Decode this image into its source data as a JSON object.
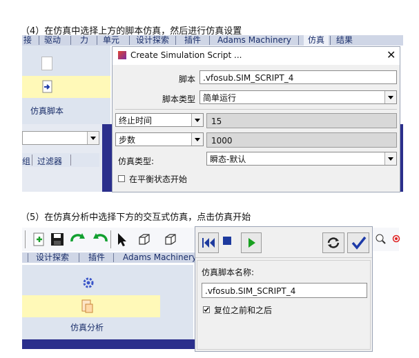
{
  "section4": {
    "caption": "（4）在仿真中选择上方的脚本仿真，然后进行仿真设置",
    "tabs": [
      "接",
      "驱动",
      "力",
      "单元",
      "设计探索",
      "插件",
      "Adams Machinery",
      "仿真",
      "结果"
    ],
    "left_panel": {
      "script_label": "仿真脚本",
      "filter_tab": "过滤器",
      "tab_partial": "组"
    },
    "dialog": {
      "title": "Create Simulation Script ...",
      "script_label": "脚本",
      "script_value": ".vfosub.SIM_SCRIPT_4",
      "script_type_label": "脚本类型",
      "script_type_value": "简单运行",
      "end_time_label": "终止时间",
      "end_time_value": "15",
      "steps_label": "步数",
      "steps_value": "1000",
      "sim_type_label": "仿真类型:",
      "sim_type_value": "瞬态-默认",
      "equilibrium_label": "在平衡状态开始"
    }
  },
  "section5": {
    "caption": "（5）在仿真分析中选择下方的交互式仿真，点击仿真开始",
    "tabs": [
      "设计探索",
      "插件",
      "Adams Machinery"
    ],
    "left_panel": {
      "label": "仿真分析"
    },
    "dialog": {
      "script_name_label": "仿真脚本名称:",
      "script_name_value": ".vfosub.SIM_SCRIPT_4",
      "reset_label": "复位之前和之后"
    }
  },
  "colors": {
    "tab_bg": "#cfd6e6",
    "highlight": "#fff9b8",
    "viewport": "#2b2f8c"
  }
}
